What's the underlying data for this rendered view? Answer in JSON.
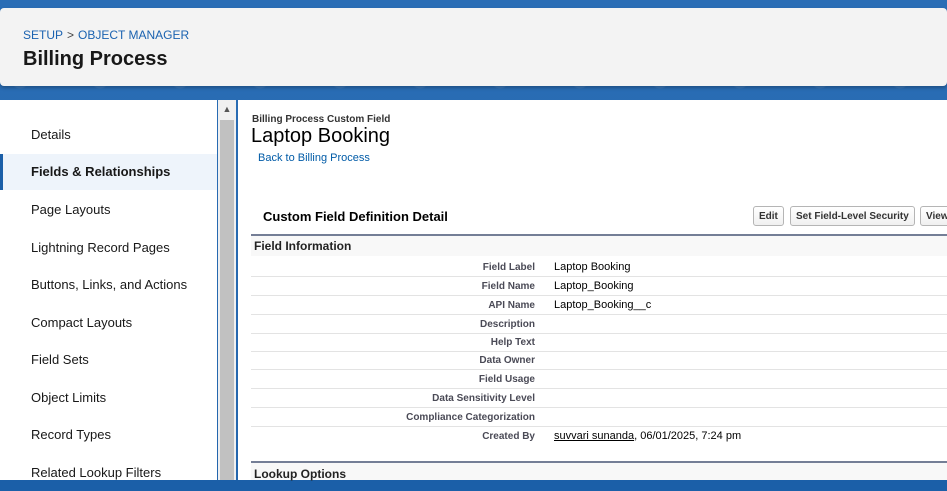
{
  "header": {
    "breadcrumb": [
      "SETUP",
      "OBJECT MANAGER"
    ],
    "breadcrumb_sep": ">",
    "title": "Billing Process"
  },
  "sidebar": {
    "items": [
      {
        "label": "Details"
      },
      {
        "label": "Fields & Relationships",
        "active": true
      },
      {
        "label": "Page Layouts"
      },
      {
        "label": "Lightning Record Pages"
      },
      {
        "label": "Buttons, Links, and Actions"
      },
      {
        "label": "Compact Layouts"
      },
      {
        "label": "Field Sets"
      },
      {
        "label": "Object Limits"
      },
      {
        "label": "Record Types"
      },
      {
        "label": "Related Lookup Filters"
      }
    ]
  },
  "main": {
    "object_label": "Billing Process Custom Field",
    "field_title": "Laptop Booking",
    "back_link": "Back to Billing Process",
    "detail_title": "Custom Field Definition Detail",
    "buttons": {
      "edit": "Edit",
      "fls": "Set Field-Level Security",
      "view": "View"
    },
    "section_field_info": "Field Information",
    "rows": [
      {
        "label": "Field Label",
        "value": "Laptop Booking"
      },
      {
        "label": "Field Name",
        "value": "Laptop_Booking"
      },
      {
        "label": "API Name",
        "value": "Laptop_Booking__c"
      },
      {
        "label": "Description",
        "value": ""
      },
      {
        "label": "Help Text",
        "value": ""
      },
      {
        "label": "Data Owner",
        "value": ""
      },
      {
        "label": "Field Usage",
        "value": ""
      },
      {
        "label": "Data Sensitivity Level",
        "value": ""
      },
      {
        "label": "Compliance Categorization",
        "value": ""
      }
    ],
    "created_by": {
      "label": "Created By",
      "user": "suvvari sunanda",
      "date": ", 06/01/2025, 7:24 pm"
    },
    "section_lookup": "Lookup Options"
  }
}
